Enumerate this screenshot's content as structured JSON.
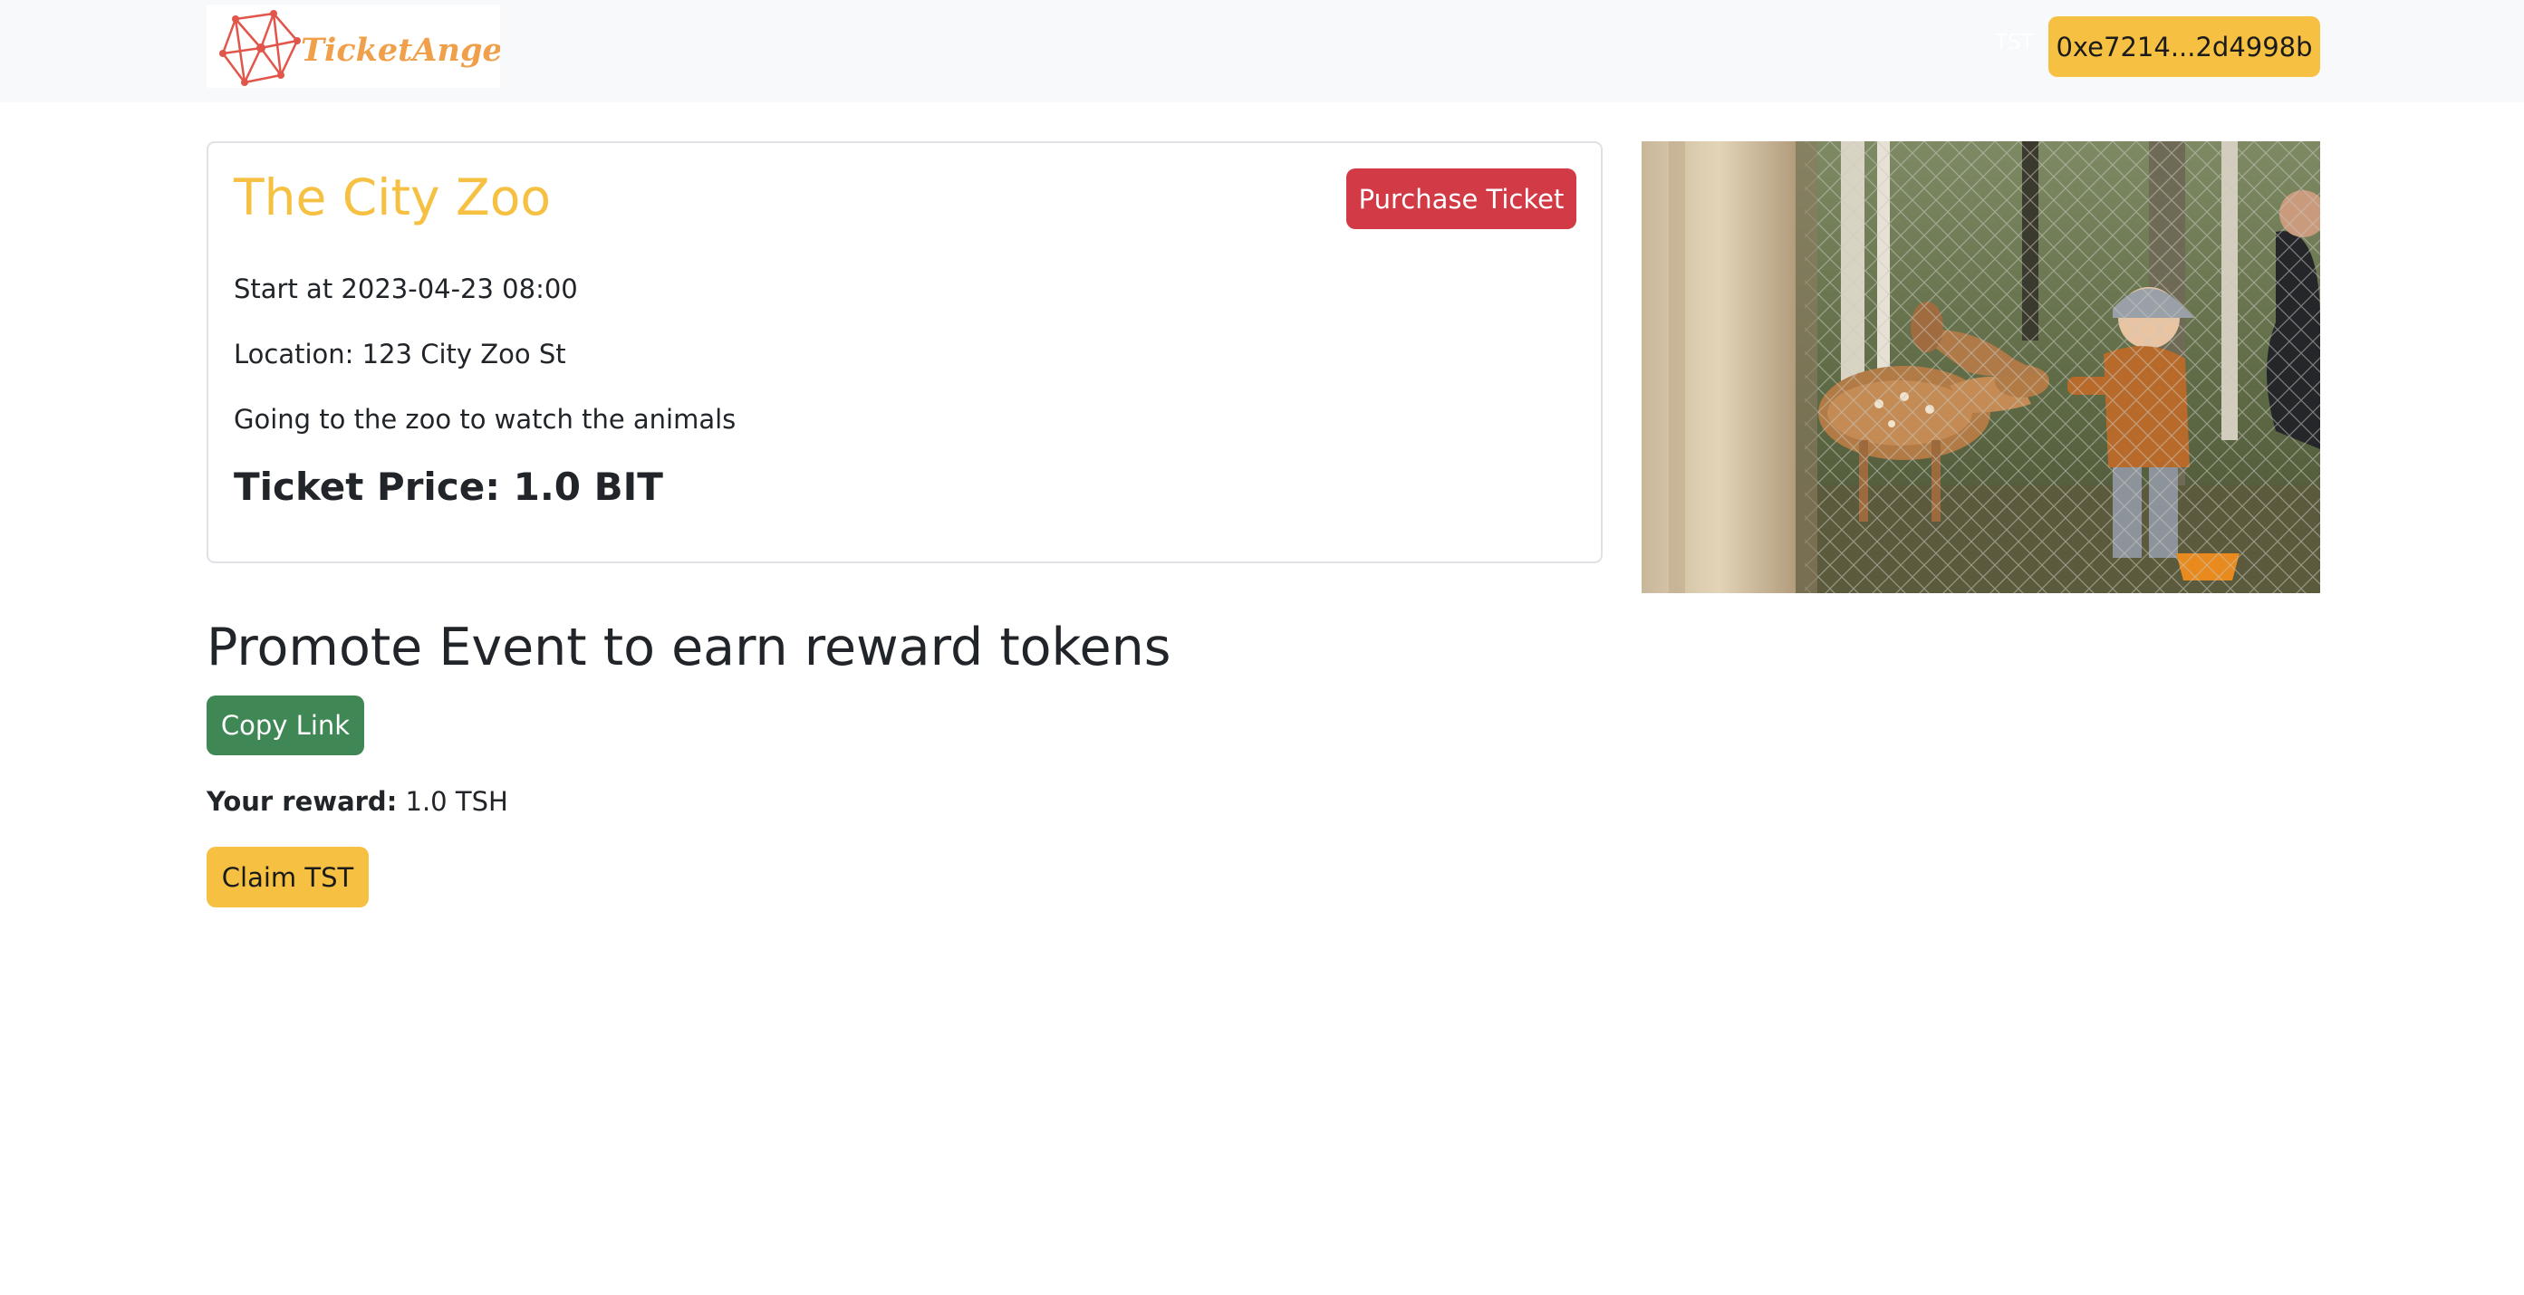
{
  "navbar": {
    "logo_text": "TicketAngel",
    "token_label": "TST",
    "wallet_label": "0xe7214...2d4998b"
  },
  "event": {
    "title": "The City Zoo",
    "purchase_label": "Purchase Ticket",
    "start": "Start at 2023-04-23 08:00",
    "location": "Location: 123 City Zoo St",
    "description": "Going to the zoo to watch the animals",
    "price": "Ticket Price: 1.0 BIT",
    "image_alt": "Child feeding deer at the zoo fence"
  },
  "promo": {
    "heading": "Promote Event to earn reward tokens",
    "copy_label": "Copy Link",
    "reward_label": "Your reward:",
    "reward_value": " 1.0 TSH",
    "claim_label": "Claim TST"
  },
  "colors": {
    "accent_yellow": "#f6c142",
    "danger_red": "#d23a45",
    "success_green": "#3f8755",
    "navbar_bg": "#f8f9fa"
  }
}
